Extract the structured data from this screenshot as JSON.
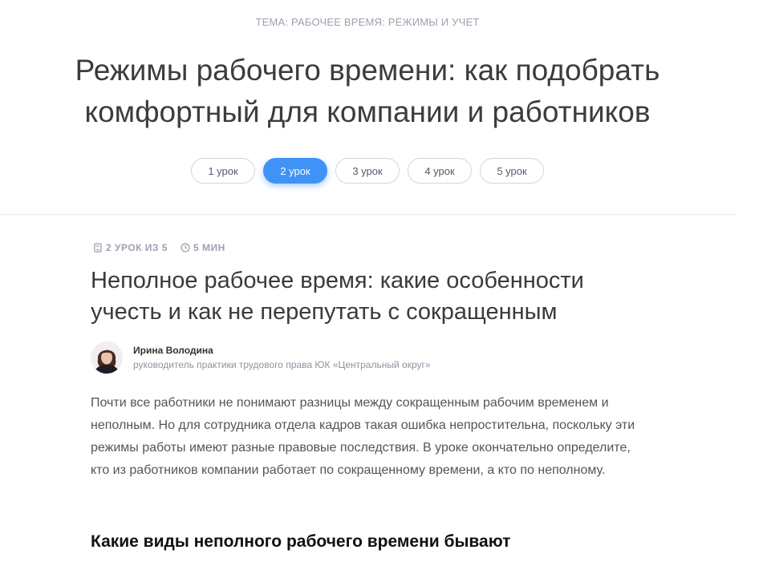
{
  "topic": "ТЕМА: РАБОЧЕЕ ВРЕМЯ: РЕЖИМЫ И УЧЕТ",
  "course_title": {
    "line1": "Режимы рабочего времени: как подобрать",
    "line2": "комфортный для компании и работников"
  },
  "lessons": [
    {
      "label": "1 урок",
      "active": false
    },
    {
      "label": "2 урок",
      "active": true
    },
    {
      "label": "3 урок",
      "active": false
    },
    {
      "label": "4 урок",
      "active": false
    },
    {
      "label": "5 урок",
      "active": false
    }
  ],
  "meta": {
    "lesson_progress": "2 УРОК ИЗ 5",
    "duration": "5 МИН",
    "lesson_icon": "book-icon",
    "duration_icon": "clock-icon"
  },
  "lesson_title": {
    "line1": "Неполное рабочее время: какие особенности",
    "line2": "учесть и как не перепутать с сокращенным"
  },
  "author": {
    "name": "Ирина Володина",
    "role": "руководитель практики трудового права ЮК «Центральный округ»"
  },
  "intro": "Почти все работники не понимают разницы между сокращенным рабочим временем и неполным. Но для сотрудника отдела кадров такая ошибка непростительна, поскольку эти режимы работы имеют разные правовые последствия. В уроке окончательно определите, кто из работников компании работает по сокращенному времени, а кто по неполному.",
  "section_heading": "Какие виды неполного рабочего времени бывают",
  "colors": {
    "accent": "#3f93f7",
    "muted": "#9da1b0",
    "border": "#d3d6df"
  }
}
